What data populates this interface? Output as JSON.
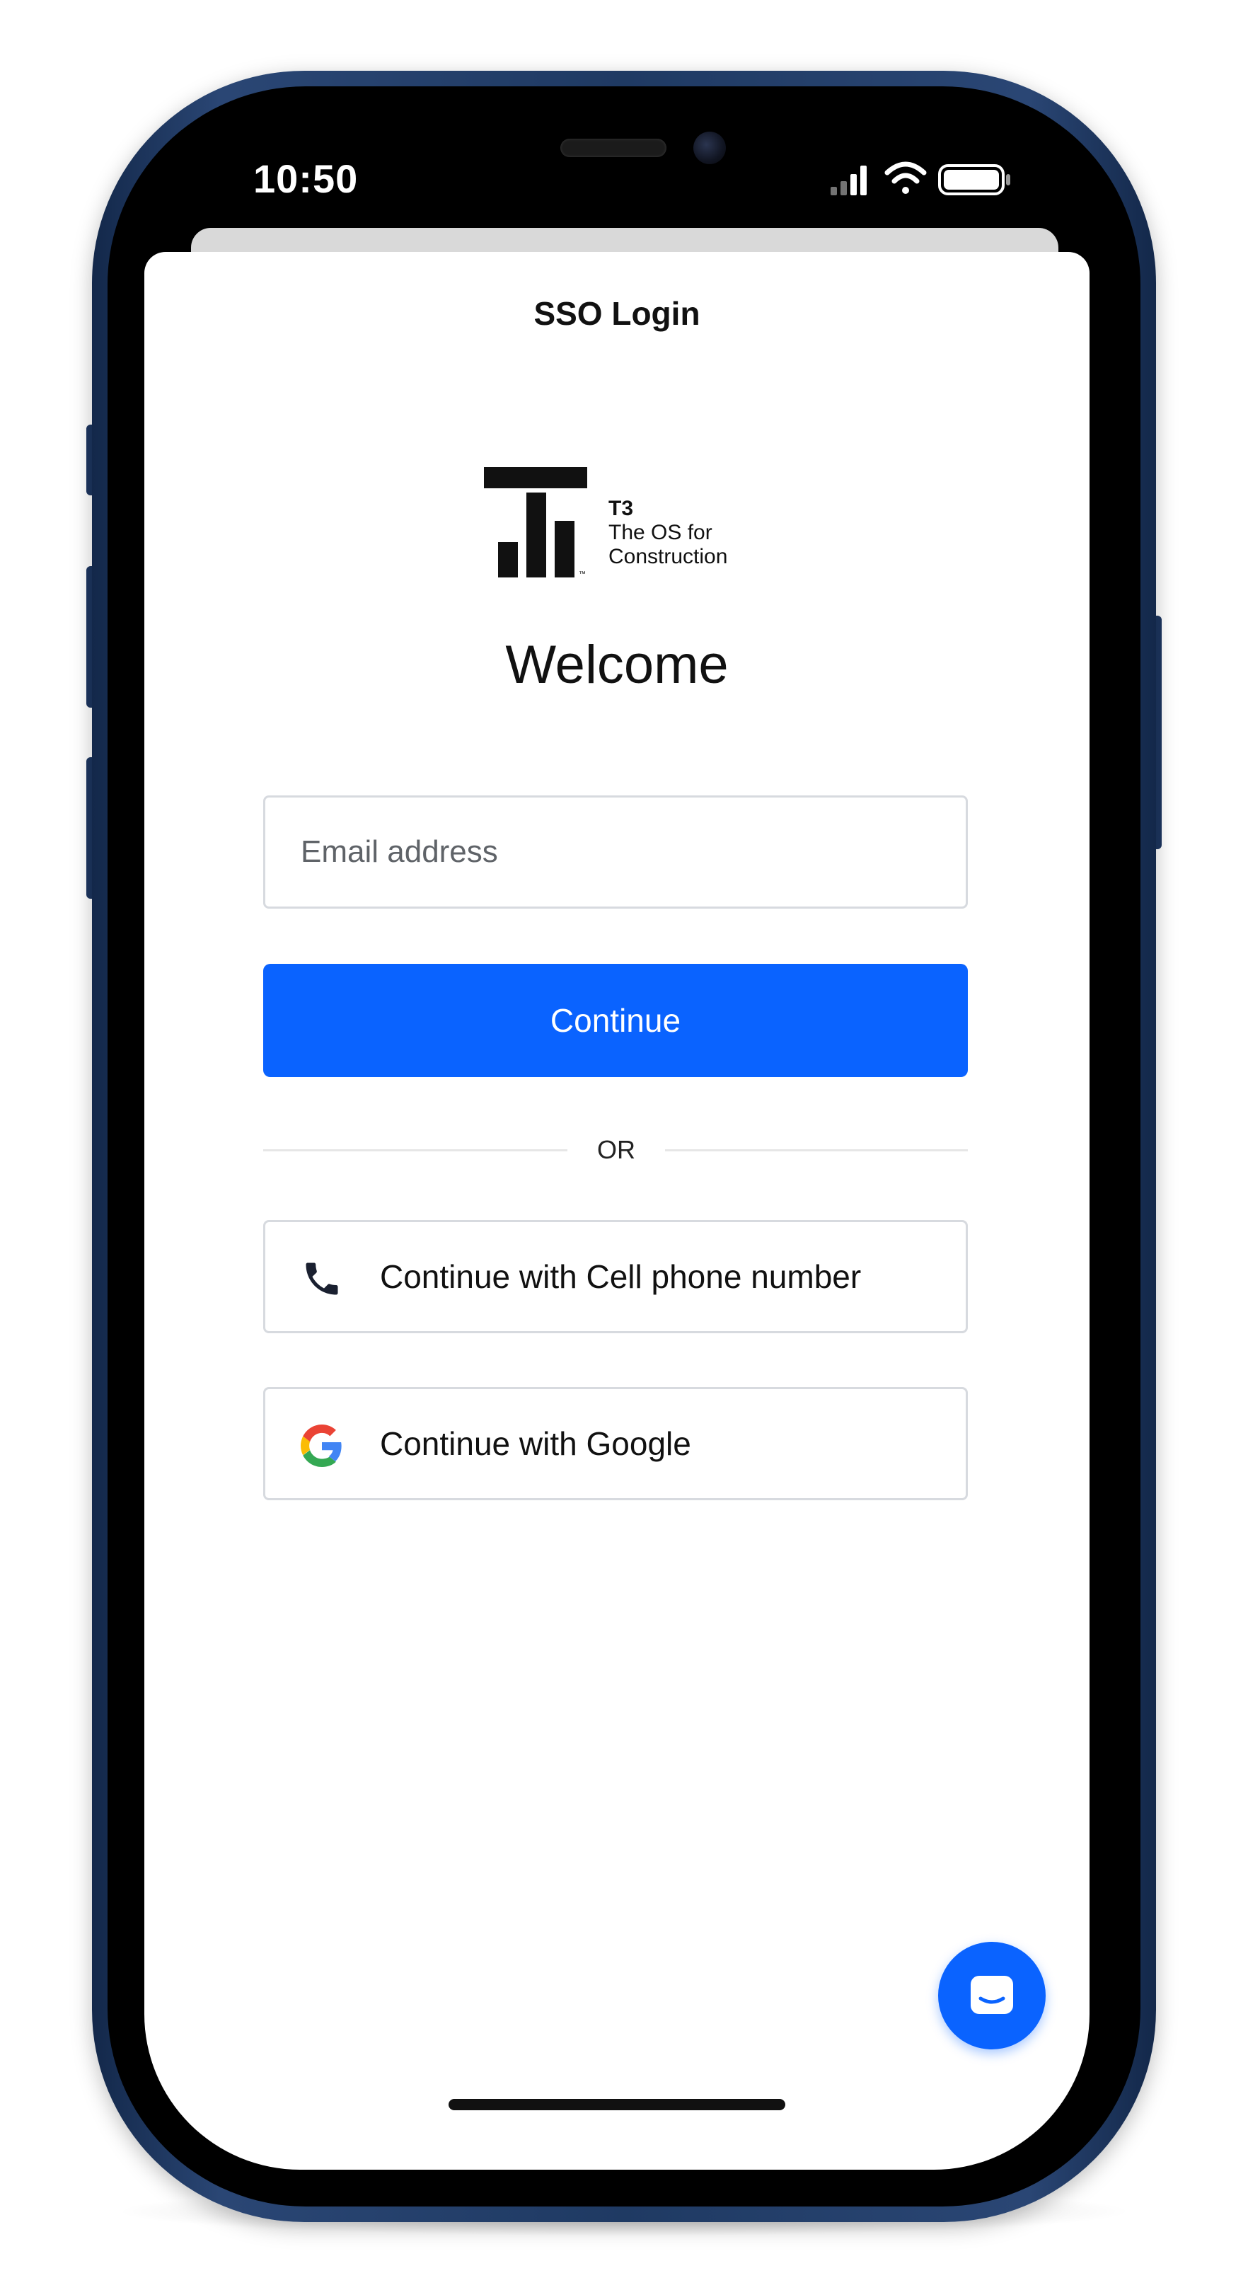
{
  "status_bar": {
    "time": "10:50"
  },
  "header": {
    "title": "SSO Login"
  },
  "logo": {
    "brand": "T3",
    "tagline_line1": "The OS for",
    "tagline_line2": "Construction",
    "icon": "t3-logo-icon"
  },
  "welcome": {
    "heading": "Welcome"
  },
  "form": {
    "email_placeholder": "Email address",
    "email_value": "",
    "continue_label": "Continue",
    "or_label": "OR"
  },
  "alternatives": [
    {
      "label": "Continue with Cell phone number",
      "icon": "phone-icon"
    },
    {
      "label": "Continue with Google",
      "icon": "google-icon"
    }
  ],
  "chat": {
    "icon": "chat-icon"
  },
  "colors": {
    "primary": "#0a63ff",
    "text": "#111111",
    "border": "#d7dadf",
    "phone_frame": "#1f3a63"
  }
}
